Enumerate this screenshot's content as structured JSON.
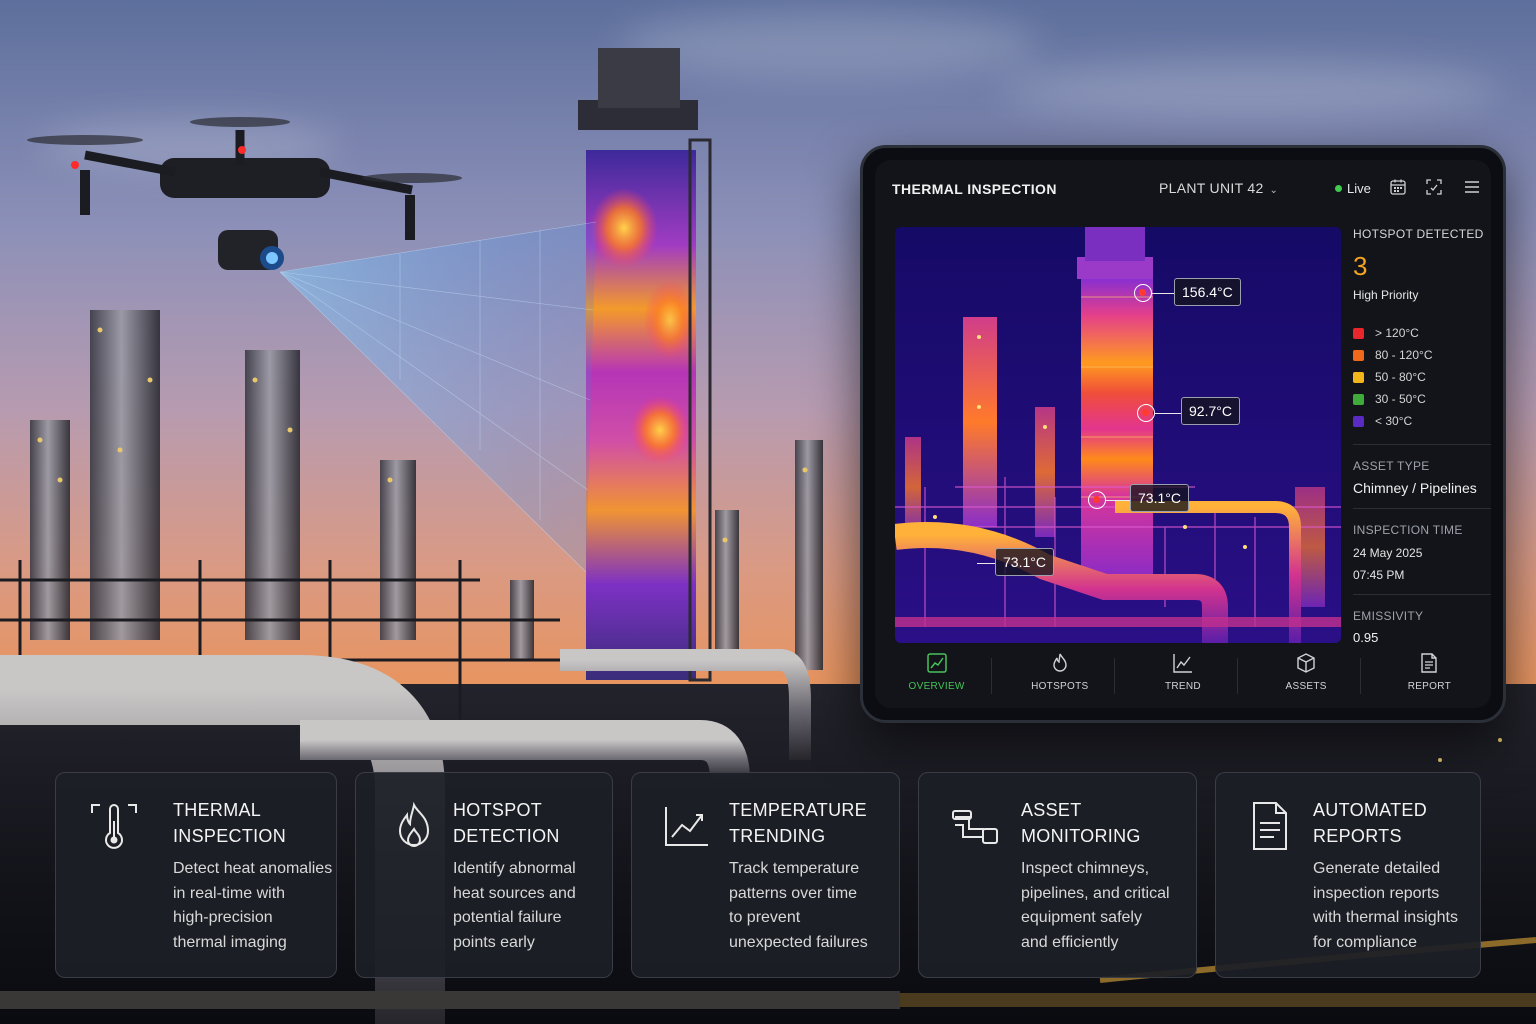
{
  "app": {
    "title": "THERMAL INSPECTION",
    "plant_unit": "PLANT UNIT 42",
    "status": "Live"
  },
  "toolbar": {
    "icons": [
      "calendar-icon",
      "scan-icon",
      "menu-icon"
    ]
  },
  "thermal_view": {
    "readings": [
      {
        "label": "156.4°C"
      },
      {
        "label": "92.7°C"
      },
      {
        "label": "73.1°C"
      },
      {
        "label": "73.1°C"
      }
    ]
  },
  "sidebar": {
    "hotspot_caption": "HOTSPOT DETECTED",
    "hotspot_count": "3",
    "priority": "High Priority",
    "legend": [
      {
        "label": "> 120°C",
        "color": "#e8262b"
      },
      {
        "label": "80 - 120°C",
        "color": "#f0691b"
      },
      {
        "label": "50 - 80°C",
        "color": "#f2b61b"
      },
      {
        "label": "30 - 50°C",
        "color": "#3fab3a"
      },
      {
        "label": "< 30°C",
        "color": "#5a2bc4"
      }
    ],
    "asset_type_caption": "ASSET TYPE",
    "asset_type": "Chimney / Pipelines",
    "inspection_time_caption": "INSPECTION TIME",
    "inspection_date": "24 May 2025",
    "inspection_clock": "07:45 PM",
    "emissivity_caption": "EMISSIVITY",
    "emissivity": "0.95"
  },
  "nav": {
    "items": [
      {
        "label": "OVERVIEW",
        "icon": "overview-icon",
        "active": true
      },
      {
        "label": "HOTSPOTS",
        "icon": "flame-icon",
        "active": false
      },
      {
        "label": "TREND",
        "icon": "trend-icon",
        "active": false
      },
      {
        "label": "ASSETS",
        "icon": "assets-icon",
        "active": false
      },
      {
        "label": "REPORT",
        "icon": "report-icon",
        "active": false
      }
    ]
  },
  "features": [
    {
      "title": "THERMAL\nINSPECTION",
      "desc": "Detect heat anomalies\nin real-time with\nhigh-precision\nthermal imaging",
      "icon": "thermometer-icon"
    },
    {
      "title": "HOTSPOT\nDETECTION",
      "desc": "Identify abnormal\nheat sources and\npotential failure\npoints early",
      "icon": "flame-icon"
    },
    {
      "title": "TEMPERATURE\nTRENDING",
      "desc": "Track temperature\npatterns over time\nto prevent\nunexpected failures",
      "icon": "trend-chart-icon"
    },
    {
      "title": "ASSET\nMONITORING",
      "desc": "Inspect chimneys,\npipelines, and critical\nequipment safely\nand efficiently",
      "icon": "pipeline-icon"
    },
    {
      "title": "AUTOMATED\nREPORTS",
      "desc": "Generate detailed\ninspection reports\nwith thermal insights\nfor compliance",
      "icon": "document-icon"
    }
  ]
}
